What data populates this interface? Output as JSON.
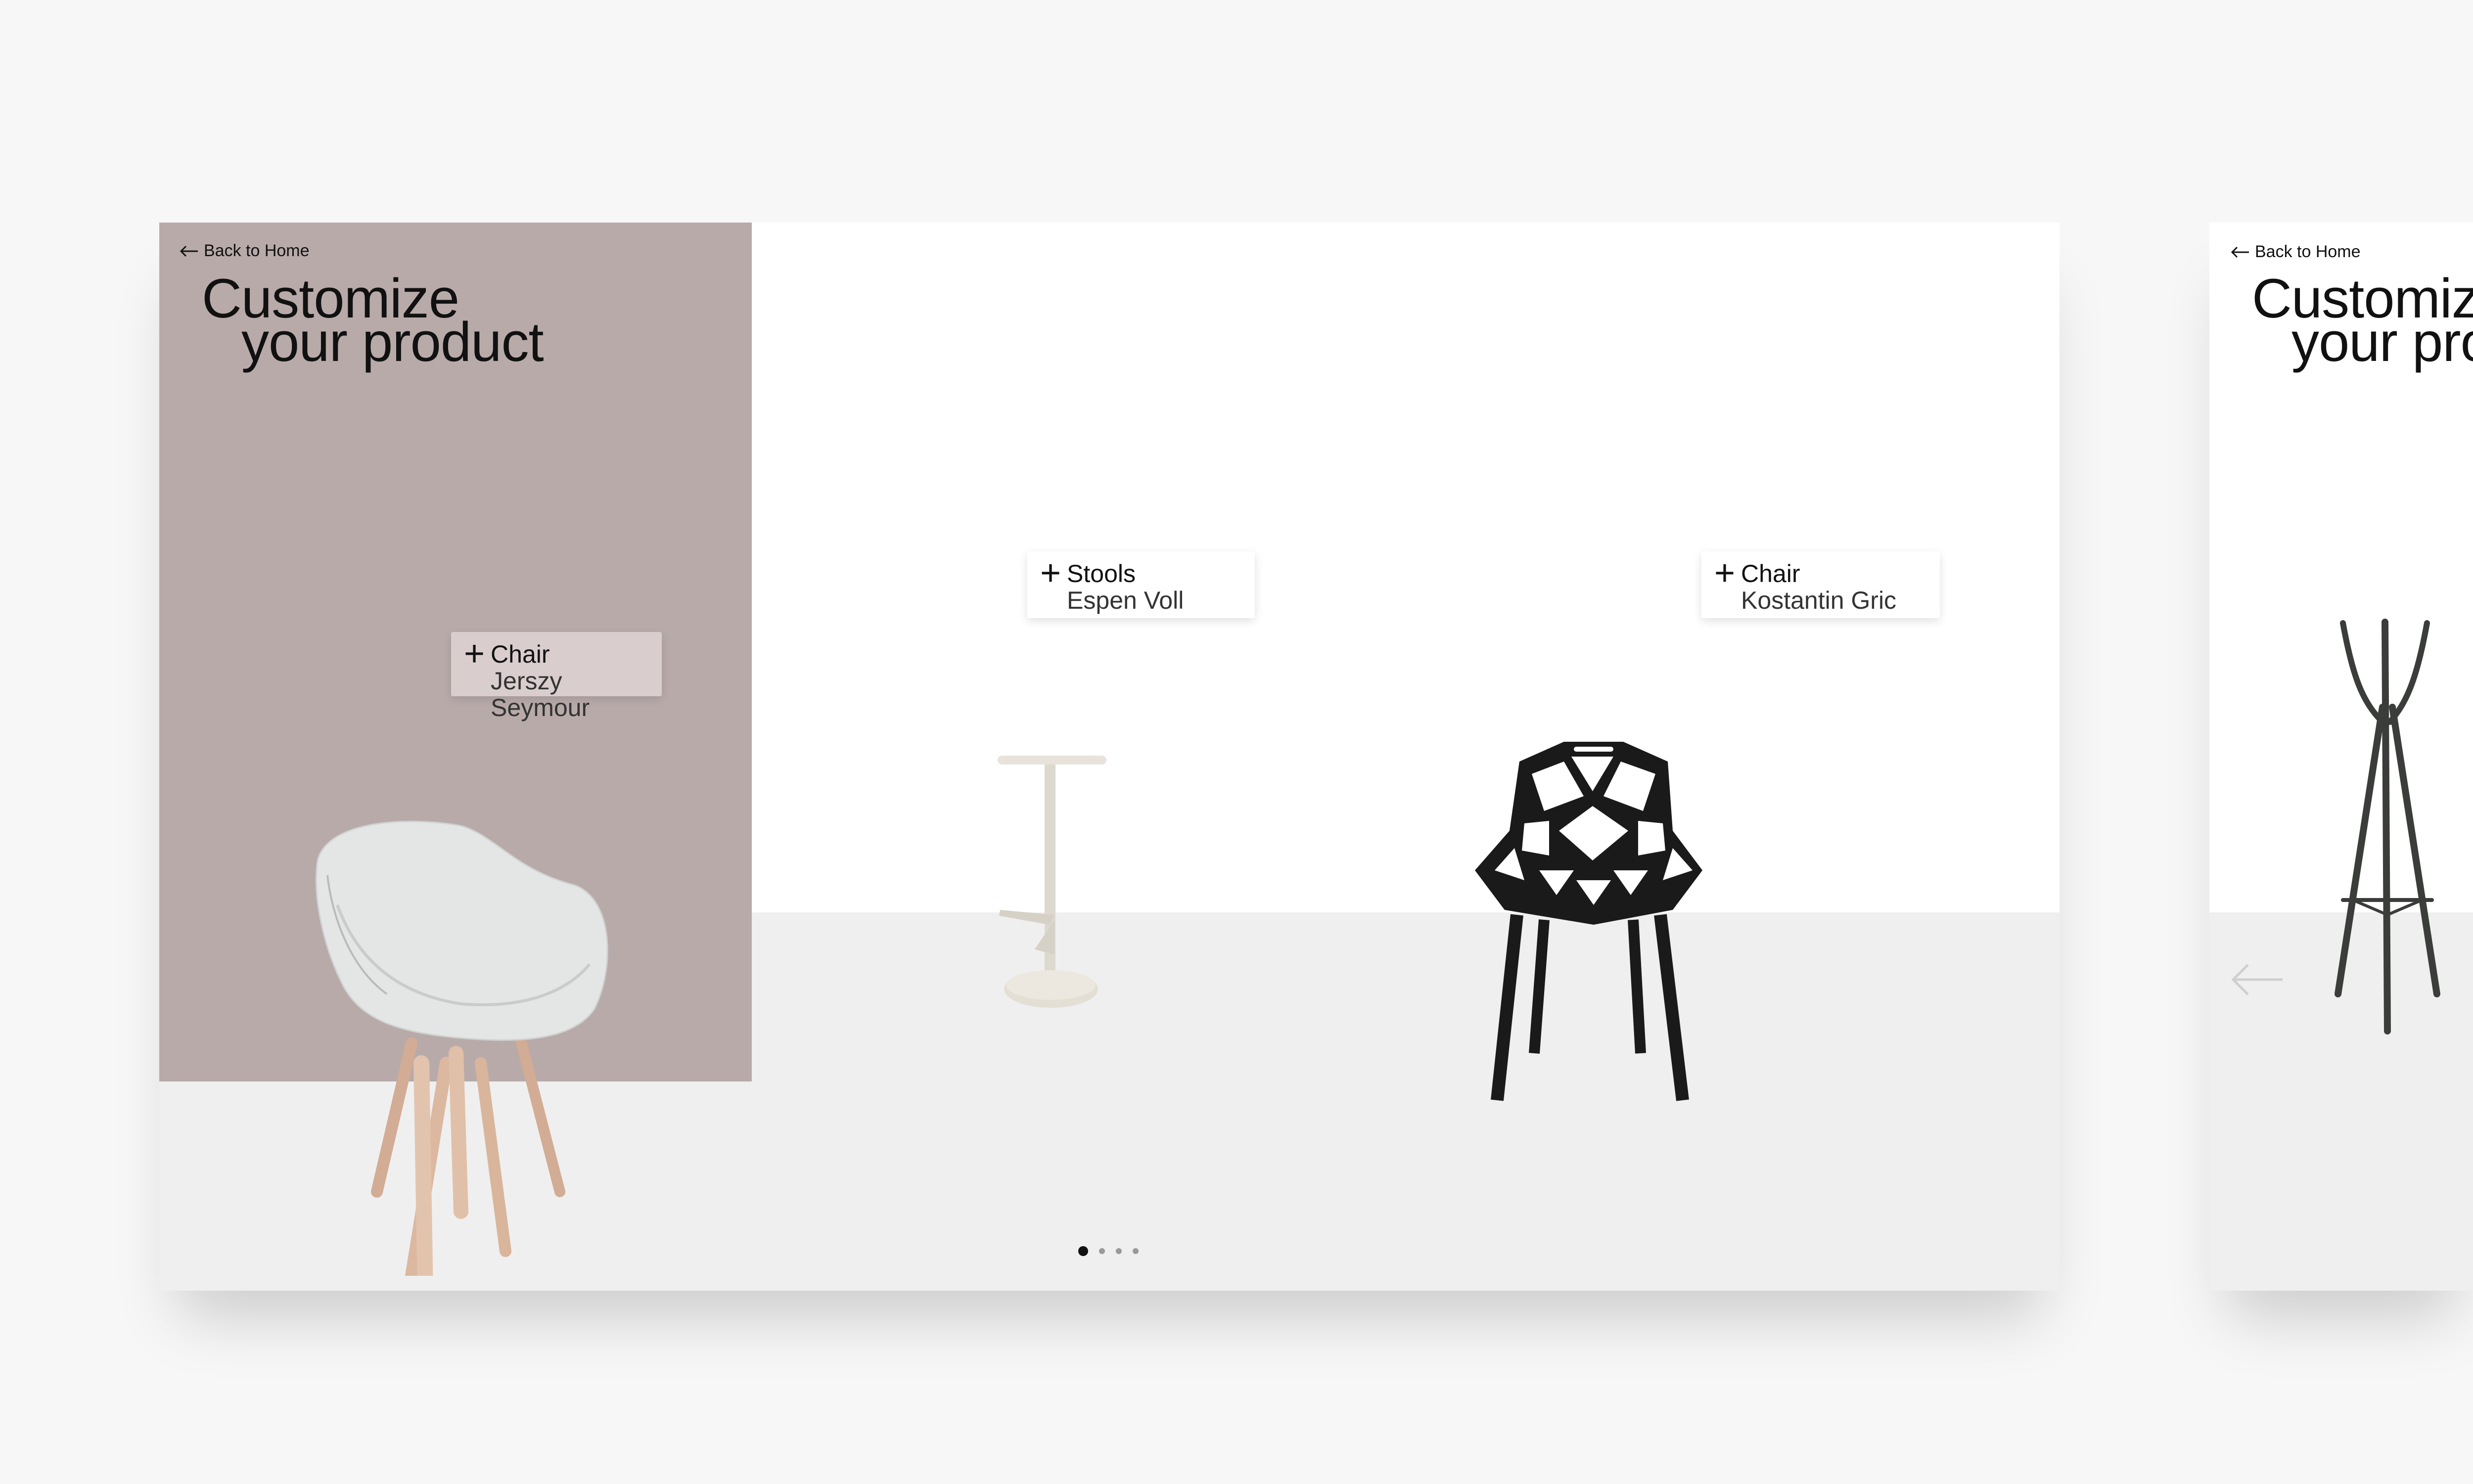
{
  "colors": {
    "page_bg": "#f7f7f7",
    "panel_bg": "#b9aaaa",
    "floor_bg": "#efefef",
    "tag_on_panel_bg": "#d9cdcd"
  },
  "main_screen": {
    "back_label": "Back to Home",
    "title_line1": "Customize",
    "title_line2": "your product",
    "products": [
      {
        "category": "Chair",
        "designer": "Jerszy Seymour",
        "icon": "plus-icon"
      },
      {
        "category": "Stools",
        "designer": "Espen Voll",
        "icon": "plus-icon"
      },
      {
        "category": "Chair",
        "designer": "Kostantin Gric",
        "icon": "plus-icon"
      }
    ],
    "pagination": {
      "total": 4,
      "active": 1
    },
    "next_arrow_icon": "arrow-right-icon"
  },
  "next_screen": {
    "back_label": "Back to Home",
    "title_line1": "Customiz",
    "title_line2": "your pro",
    "prev_arrow_icon": "arrow-left-icon"
  }
}
